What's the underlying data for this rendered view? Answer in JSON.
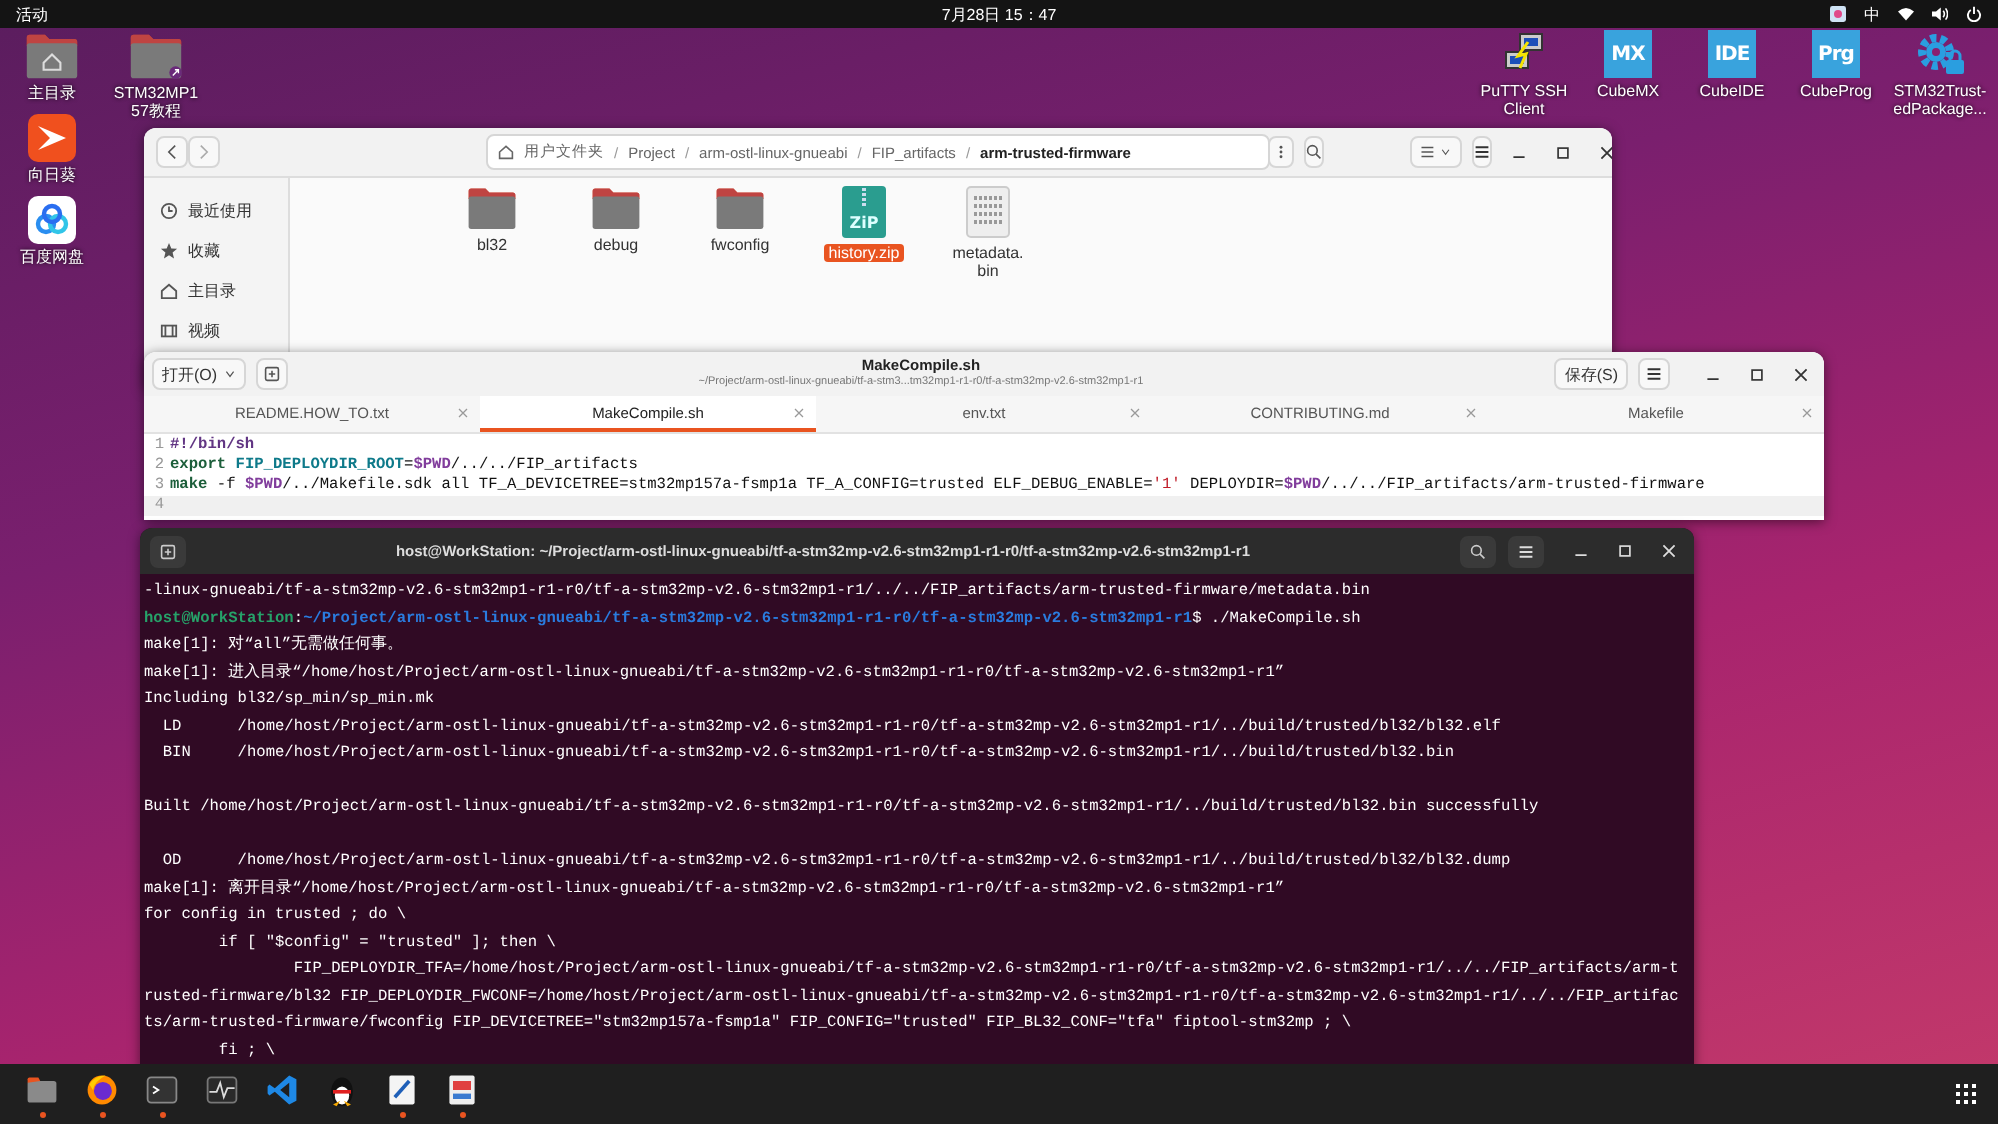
{
  "top_bar": {
    "activities": "活动",
    "clock": "7月28日 15：47",
    "input_method": "中"
  },
  "desktop": {
    "column_1": [
      {
        "kind": "home-folder",
        "label": "主目录"
      },
      {
        "kind": "sunflower",
        "label": "向日葵"
      },
      {
        "kind": "cloud",
        "label": "百度网盘"
      }
    ],
    "column_2": [
      {
        "kind": "link-folder",
        "label": "STM32MP157教程"
      }
    ],
    "right": [
      {
        "kind": "putty",
        "label": "PuTTY SSH Client"
      },
      {
        "kind": "tile",
        "badge": "MX",
        "label": "CubeMX"
      },
      {
        "kind": "tile",
        "badge": "IDE",
        "label": "CubeIDE"
      },
      {
        "kind": "tile",
        "badge": "Prg",
        "label": "CubeProg"
      },
      {
        "kind": "gear-lock",
        "label": "STM32Trust-edPackage..."
      }
    ]
  },
  "file_manager": {
    "path": [
      {
        "label": "用户文件夹",
        "current": false
      },
      {
        "separator": "/",
        "label": "Project",
        "current": false
      },
      {
        "separator": "/",
        "label": "arm-ostl-linux-gnueabi",
        "current": false
      },
      {
        "separator": "/",
        "label": "FIP_artifacts",
        "current": false
      },
      {
        "separator": "/",
        "label": "arm-trusted-firmware",
        "current": true
      }
    ],
    "sidebar": [
      {
        "kind": "recent",
        "label": "最近使用"
      },
      {
        "kind": "starred",
        "label": "收藏"
      },
      {
        "kind": "home",
        "label": "主目录"
      },
      {
        "kind": "videos",
        "label": "视频"
      }
    ],
    "files": [
      {
        "kind": "folder",
        "name": "bl32",
        "selected": false
      },
      {
        "kind": "folder",
        "name": "debug",
        "selected": false
      },
      {
        "kind": "folder",
        "name": "fwconfig",
        "selected": false
      },
      {
        "kind": "zip",
        "badge": "ZiP",
        "name": "history.zip",
        "selected": true
      },
      {
        "kind": "binary",
        "name": "metadata.bin",
        "selected": false
      }
    ]
  },
  "editor": {
    "open_button": "打开(O)",
    "title": "MakeCompile.sh",
    "subtitle": "~/Project/arm-ostl-linux-gnueabi/tf-a-stm3...tm32mp1-r1-r0/tf-a-stm32mp-v2.6-stm32mp1-r1",
    "save_button": "保存(S)",
    "tabs": [
      {
        "label": "README.HOW_TO.txt",
        "selected": false
      },
      {
        "label": "MakeCompile.sh",
        "selected": true
      },
      {
        "label": "env.txt",
        "selected": false
      },
      {
        "label": "CONTRIBUTING.md",
        "selected": false
      },
      {
        "label": "Makefile",
        "selected": false
      }
    ],
    "lines": [
      {
        "number": "1",
        "current": false,
        "tokens": [
          {
            "kind": "shebang",
            "text": "#!/bin/sh"
          }
        ]
      },
      {
        "number": "2",
        "current": false,
        "tokens": [
          {
            "kind": "keyword",
            "text": "export "
          },
          {
            "kind": "name",
            "text": "FIP_DEPLOYDIR_ROOT"
          },
          {
            "kind": "plain",
            "text": "="
          },
          {
            "kind": "var",
            "text": "$PWD"
          },
          {
            "kind": "plain",
            "text": "/../../FIP_artifacts"
          }
        ]
      },
      {
        "number": "3",
        "current": false,
        "tokens": [
          {
            "kind": "keyword",
            "text": "make"
          },
          {
            "kind": "plain",
            "text": " -f "
          },
          {
            "kind": "var",
            "text": "$PWD"
          },
          {
            "kind": "plain",
            "text": "/../Makefile.sdk all TF_A_DEVICETREE=stm32mp157a-fsmp1a TF_A_CONFIG=trusted ELF_DEBUG_ENABLE="
          },
          {
            "kind": "string",
            "text": "'1'"
          },
          {
            "kind": "plain",
            "text": " DEPLOYDIR="
          },
          {
            "kind": "var",
            "text": "$PWD"
          },
          {
            "kind": "plain",
            "text": "/../../FIP_artifacts/arm-trusted-firmware"
          }
        ]
      },
      {
        "number": "4",
        "current": true
      }
    ]
  },
  "terminal": {
    "title": "host@WorkStation: ~/Project/arm-ostl-linux-gnueabi/tf-a-stm32mp-v2.6-stm32mp1-r1-r0/tf-a-stm32mp-v2.6-stm32mp1-r1",
    "lines": [
      {
        "kind": "output",
        "text": "-linux-gnueabi/tf-a-stm32mp-v2.6-stm32mp1-r1-r0/tf-a-stm32mp-v2.6-stm32mp1-r1/../../FIP_artifacts/arm-trusted-firmware/metadata.bin"
      },
      {
        "kind": "prompt",
        "user": "host@WorkStation",
        "separator": ":",
        "path": "~/Project/arm-ostl-linux-gnueabi/tf-a-stm32mp-v2.6-stm32mp1-r1-r0/tf-a-stm32mp-v2.6-stm32mp1-r1",
        "command": "$ ./MakeCompile.sh"
      },
      {
        "kind": "output",
        "text": "make[1]: 对“all”无需做任何事。"
      },
      {
        "kind": "output",
        "text": "make[1]: 进入目录“/home/host/Project/arm-ostl-linux-gnueabi/tf-a-stm32mp-v2.6-stm32mp1-r1-r0/tf-a-stm32mp-v2.6-stm32mp1-r1”"
      },
      {
        "kind": "output",
        "text": "Including bl32/sp_min/sp_min.mk"
      },
      {
        "kind": "output",
        "text": "  LD      /home/host/Project/arm-ostl-linux-gnueabi/tf-a-stm32mp-v2.6-stm32mp1-r1-r0/tf-a-stm32mp-v2.6-stm32mp1-r1/../build/trusted/bl32/bl32.elf"
      },
      {
        "kind": "output",
        "text": "  BIN     /home/host/Project/arm-ostl-linux-gnueabi/tf-a-stm32mp-v2.6-stm32mp1-r1-r0/tf-a-stm32mp-v2.6-stm32mp1-r1/../build/trusted/bl32.bin"
      },
      {
        "kind": "blank"
      },
      {
        "kind": "output",
        "text": "Built /home/host/Project/arm-ostl-linux-gnueabi/tf-a-stm32mp-v2.6-stm32mp1-r1-r0/tf-a-stm32mp-v2.6-stm32mp1-r1/../build/trusted/bl32.bin successfully"
      },
      {
        "kind": "blank"
      },
      {
        "kind": "output",
        "text": "  OD      /home/host/Project/arm-ostl-linux-gnueabi/tf-a-stm32mp-v2.6-stm32mp1-r1-r0/tf-a-stm32mp-v2.6-stm32mp1-r1/../build/trusted/bl32/bl32.dump"
      },
      {
        "kind": "output",
        "text": "make[1]: 离开目录“/home/host/Project/arm-ostl-linux-gnueabi/tf-a-stm32mp-v2.6-stm32mp1-r1-r0/tf-a-stm32mp-v2.6-stm32mp1-r1”"
      },
      {
        "kind": "output",
        "text": "for config in trusted ; do \\"
      },
      {
        "kind": "output",
        "text": "        if [ \"$config\" = \"trusted\" ]; then \\"
      },
      {
        "kind": "output",
        "text": "                FIP_DEPLOYDIR_TFA=/home/host/Project/arm-ostl-linux-gnueabi/tf-a-stm32mp-v2.6-stm32mp1-r1-r0/tf-a-stm32mp-v2.6-stm32mp1-r1/../../FIP_artifacts/arm-t"
      },
      {
        "kind": "output",
        "text": "rusted-firmware/bl32 FIP_DEPLOYDIR_FWCONF=/home/host/Project/arm-ostl-linux-gnueabi/tf-a-stm32mp-v2.6-stm32mp1-r1-r0/tf-a-stm32mp-v2.6-stm32mp1-r1/../../FIP_artifac"
      },
      {
        "kind": "output",
        "text": "ts/arm-trusted-firmware/fwconfig FIP_DEVICETREE=\"stm32mp157a-fsmp1a\" FIP_CONFIG=\"trusted\" FIP_BL32_CONF=\"tfa\" fiptool-stm32mp ; \\"
      },
      {
        "kind": "output",
        "text": "        fi ; \\"
      }
    ]
  },
  "dock": {
    "apps": [
      {
        "kind": "files",
        "running": true
      },
      {
        "kind": "browser",
        "running": true
      },
      {
        "kind": "terminal",
        "running": true
      },
      {
        "kind": "monitor",
        "running": false
      },
      {
        "kind": "code",
        "running": false
      },
      {
        "kind": "penguin",
        "running": false
      },
      {
        "kind": "text-editor",
        "running": true
      },
      {
        "kind": "app",
        "running": true
      }
    ]
  }
}
